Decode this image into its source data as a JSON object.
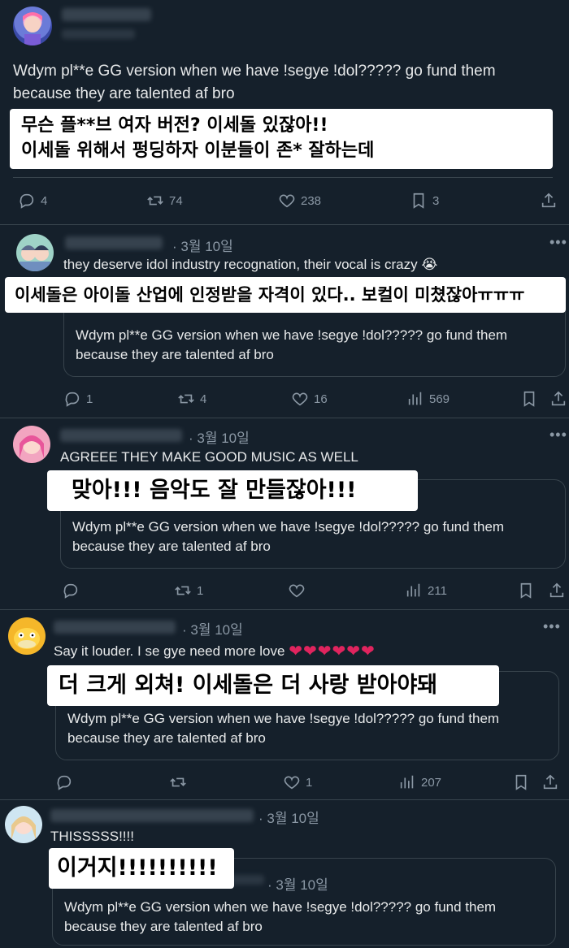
{
  "main_tweet": {
    "text": "Wdym pl**e GG version when we have !segye !dol????? go fund them because they are talented af bro",
    "translation_line1": "무슨 플**브 여자 버전? 이세돌 있잖아!!",
    "translation_line2": "이세돌 위해서 펑딩하자 이분들이 존* 잘하는데",
    "actions": {
      "replies": "4",
      "retweets": "74",
      "likes": "238",
      "bookmarks": "3"
    }
  },
  "replies": [
    {
      "date": "· 3월 10일",
      "text": "they deserve idol industry recognation, their vocal is crazy",
      "emoji": "😭",
      "translation": "이세돌은 아이돌 산업에 인정받을 자격이 있다.. 보컬이 미쳤잖아ㅠㅠㅠ",
      "quote_text": "Wdym pl**e GG version when we have !segye !dol????? go fund them because they are talented af bro",
      "actions": {
        "replies": "1",
        "retweets": "4",
        "likes": "16",
        "views": "569"
      }
    },
    {
      "date": "· 3월 10일",
      "text": "AGREEE THEY MAKE GOOD MUSIC AS WELL",
      "translation": "맞아!!! 음악도 잘 만들잖아!!!",
      "quote_text": "Wdym pl**e GG version when we have !segye !dol????? go fund them because they are talented af bro",
      "actions": {
        "replies": "",
        "retweets": "1",
        "likes": "",
        "views": "211"
      }
    },
    {
      "date": "· 3월 10일",
      "text": "Say it louder. I se gye need more love",
      "hearts": "❤❤❤❤❤❤",
      "translation": "더 크게 외쳐! 이세돌은 더 사랑 받아야돼",
      "quote_text": "Wdym pl**e GG version when we have !segye !dol????? go fund them because they are talented af bro",
      "actions": {
        "replies": "",
        "retweets": "",
        "likes": "1",
        "views": "207"
      }
    },
    {
      "date": "· 3월 10일",
      "text": "THISSSSS!!!!",
      "translation": "이거지!!!!!!!!!!",
      "quote_date": "· 3월 10일",
      "quote_text": "Wdym pl**e GG version when we have !segye !dol????? go fund them because they are talented af bro"
    }
  ],
  "colors": {
    "background": "#15202b",
    "text": "#e7e9ea",
    "muted": "#8b98a5",
    "border": "#38444d",
    "heart": "#e0245e"
  },
  "icons": [
    "reply-icon",
    "retweet-icon",
    "like-icon",
    "bookmark-icon",
    "share-icon",
    "views-icon",
    "more-icon"
  ]
}
